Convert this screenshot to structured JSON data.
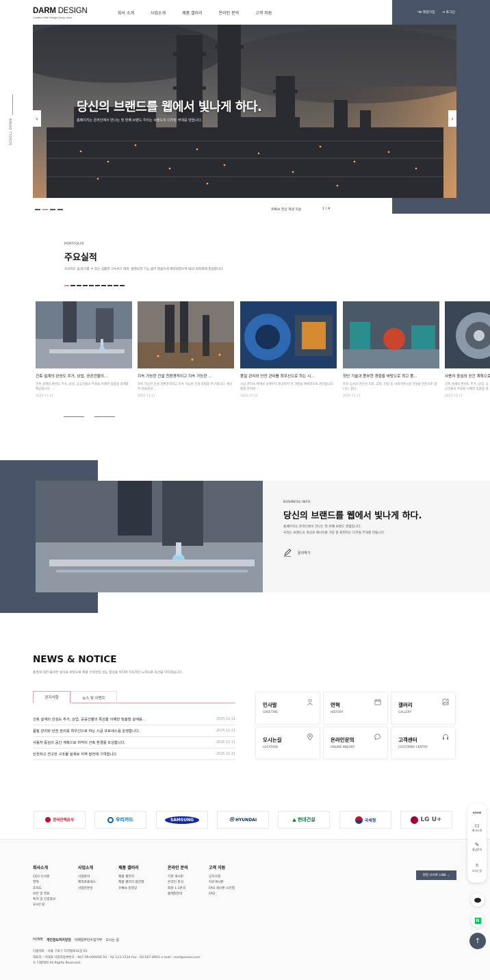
{
  "header": {
    "logo_bold": "DARM",
    "logo_light": " DESIGN",
    "logo_sub": "Creative Web Design Group darm",
    "nav": [
      "회사 소개",
      "사업소개",
      "제품 갤러리",
      "온라인 문의",
      "고객 지원"
    ],
    "join": "회원가입",
    "login": "로그인"
  },
  "hero": {
    "scroll": "SCROLL DOWN",
    "title": "당신의 브랜드를 웹에서 빛나게 하다.",
    "subtitle": "홈페이지는 온라인에서 만나는 첫 번째 브랜드 우리는 브랜드의 디지털 무대를 만듭니다.",
    "youtube": "유튜브 영상 재생 지원",
    "pager": "1 / 4"
  },
  "portfolio": {
    "kicker": "PORTFOLIO",
    "title": "주요실적",
    "desc": "초보자도 쉽게 다룰 수 있는 심플한 그누보드 테마, 불필요한 기능 없이 깔끔하게 제작되었으며 SEO 최적화에 충실합니다.",
    "cards": [
      {
        "title": "건축 설계의 완성도 주거, 상업, 공공건물의...",
        "desc": "건축 설계의 완성도 주거, 상업, 공공건물의 특성을 이해한 맞춤형 설계를 제공합니다. ...",
        "date": "2025-11-11"
      },
      {
        "title": "지속 가능한 건설 친환경적이고 지속 가능한 ...",
        "desc": "지속 가능한 건설 친환경적이고 지속 가능한 건설 방법을 추구합니다. 에너지 효율성과 ...",
        "date": "2025-11-11"
      },
      {
        "title": "품질 관리와 안전 관리를 최우선으로 하는 시...",
        "desc": "시공 관리의 체계성 설계부터 준공까지 전 과정을 체계적으로 관리합니다. 품질 관리와 ...",
        "date": "2025-11-11"
      },
      {
        "title": "정단 기술과 풍부한 경험을 바탕으로 최고 품...",
        "desc": "토목 공사의 전문성 도로, 교량, 터널 등 사회기반시설 건설을 전문으로 합니다. 첨단...",
        "date": "2025-11-11"
      },
      {
        "title": "사용자 중심의 공간 계획으로...",
        "desc": "건축 설계의 완성도 주거, 상업, 공공건물의 특성을 이해한 맞춤형 설계를 제공합니다. ...",
        "date": "2025-11-11"
      }
    ]
  },
  "business": {
    "kicker": "BUSINESS INFO",
    "title": "당신의 브랜드를 웹에서 빛나게 하다.",
    "desc1": "홈페이지는 온라인에서 만나는 첫 번째 브랜드 경험입니다.",
    "desc2": "우리는 브랜드의 개성과 메시지를 가장 잘 표현하는 디지털 무대를 만듭니다.",
    "link": "문의하기"
  },
  "news": {
    "title": "NEWS & NOTICE",
    "desc": "품질에 대한 올바른 방식을 바탕으로 제품 신뢰성및 성능 향상을 위하여 지속적인 노력으로 최선을 다하겠습니다.",
    "tabs": [
      "공지사항",
      "뉴스 및 이벤트"
    ],
    "rows": [
      {
        "t": "건축 설계의 완성도 주거, 상업, 공공건물의 특성을 이해한 맞춤형 설계를...",
        "d": "2025-11-11"
      },
      {
        "t": "품질 관리와 안전 관리를 최우선으로 하는 시공 프로세스를 운영합니다.",
        "d": "2025-11-11"
      },
      {
        "t": "사용자 중심의 공간 계획으로 최적의 건축 환경을 조성합니다.",
        "d": "2025-11-11"
      },
      {
        "t": "안전하고 견고한 구조물 설계로 지역 발전에 기여합니다.",
        "d": "2025-11-11"
      }
    ],
    "quick": [
      {
        "k": "인사말",
        "e": "GREETING",
        "icon": "person-icon"
      },
      {
        "k": "연혁",
        "e": "HISTORY",
        "icon": "calendar-icon"
      },
      {
        "k": "갤러리",
        "e": "GALLERY",
        "icon": "image-icon"
      },
      {
        "k": "오시는길",
        "e": "LOCATION",
        "icon": "map-pin-icon"
      },
      {
        "k": "온라인문의",
        "e": "ONLINE INQUIRY",
        "icon": "chat-icon"
      },
      {
        "k": "고객센터",
        "e": "CUSTOMER CENTER",
        "icon": "headset-icon"
      }
    ]
  },
  "partners": [
    "한국전력공사",
    "우리카드",
    "SAMSUNG",
    "HYUNDAI",
    "현대건설",
    "국세청",
    "LG U+"
  ],
  "partner_colors": [
    "#c8102e",
    "#0067ac",
    "#1428a0",
    "#002c5f",
    "#0a7a3a",
    "#1d3a8a",
    "#a50034"
  ],
  "footer": {
    "cols": [
      {
        "h": "회사소개",
        "items": [
          "CEO 인사말",
          "연혁",
          "조직도",
          "비전 및 목표",
          "특허 및 인증정보",
          "오시는길"
        ]
      },
      {
        "h": "사업소개",
        "items": [
          "사업분야",
          "제작프로세스",
          "사업전문성"
        ]
      },
      {
        "h": "제품 갤러리",
        "items": [
          "제품 갤러리",
          "제품 갤러리 썸진형",
          "유튜브 동영상"
        ]
      },
      {
        "h": "온라인 문의",
        "items": [
          "기본 게시판",
          "온라인 문의",
          "회원 1:1문의",
          "통제일문의"
        ]
      },
      {
        "h": "고객 지원",
        "items": [
          "공지사항",
          "자유게시판",
          "FAQ 게시판 스킨형",
          "FAQ"
        ]
      }
    ],
    "site_link": "관련 사이트 LINK  ⌄",
    "bar": [
      "HOME",
      "개인정보처리방침",
      "이메일무단수집거부",
      "오시는 길"
    ],
    "info1": "다름테마 : 서울 구로구 디지털로31길 61",
    "info2": "대표자 : 이대표      사업자등록번호 : 607-09-000000      Tel : 02-123-1234      Fax : 02-567-8901      e-mail : mail@naver.com",
    "copy": "© 다름테마 All Rights Reserved."
  },
  "quickside": {
    "home": "HOME",
    "items": [
      "회사소개",
      "질답문의",
      "오시는길"
    ]
  },
  "colors": {
    "navy": "#4a5469",
    "accent": "#d18f97"
  }
}
